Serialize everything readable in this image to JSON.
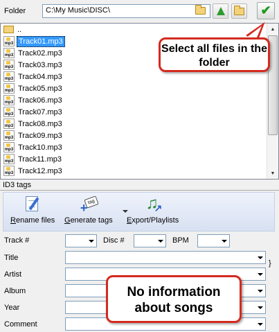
{
  "folder": {
    "label": "Folder",
    "path": "C:\\My Music\\DISC\\"
  },
  "file_list": {
    "parent": "..",
    "files": [
      {
        "name": "Track01.mp3",
        "icon": "mp3-file-icon",
        "selected": true
      },
      {
        "name": "Track02.mp3",
        "icon": "mp3-file-icon",
        "selected": false
      },
      {
        "name": "Track03.mp3",
        "icon": "mp3-file-icon",
        "selected": false
      },
      {
        "name": "Track04.mp3",
        "icon": "mp3-file-icon",
        "selected": false
      },
      {
        "name": "Track05.mp3",
        "icon": "mp3-file-icon",
        "selected": false
      },
      {
        "name": "Track06.mp3",
        "icon": "mp3-file-icon",
        "selected": false
      },
      {
        "name": "Track07.mp3",
        "icon": "mp3-file-icon",
        "selected": false
      },
      {
        "name": "Track08.mp3",
        "icon": "mp3-file-icon",
        "selected": false
      },
      {
        "name": "Track09.mp3",
        "icon": "mp3-file-icon",
        "selected": false
      },
      {
        "name": "Track10.mp3",
        "icon": "mp3-file-icon",
        "selected": false
      },
      {
        "name": "Track11.mp3",
        "icon": "mp3-file-icon",
        "selected": false
      },
      {
        "name": "Track12.mp3",
        "icon": "mp3-file-icon",
        "selected": false
      }
    ]
  },
  "id3": {
    "header": "ID3 tags",
    "toolbar": {
      "rename_files_hotkey": "R",
      "rename_files_rest": "ename files",
      "generate_tags_hotkey": "G",
      "generate_tags_rest": "enerate tags",
      "export_hotkey": "E",
      "export_rest": "xport/Playlists",
      "tag_icon_text": "tag"
    },
    "fields": {
      "track": "Track #",
      "disc": "Disc #",
      "bpm": "BPM",
      "title": "Title",
      "artist": "Artist",
      "album": "Album",
      "year": "Year",
      "comment": "Comment"
    },
    "brace": "}"
  },
  "callouts": {
    "select_all": "Select all files in the folder",
    "no_info": "No information about songs"
  },
  "colors": {
    "selection": "#3399ff",
    "callout_border": "#d42a1f",
    "confirm_check": "#1a9c1a"
  }
}
